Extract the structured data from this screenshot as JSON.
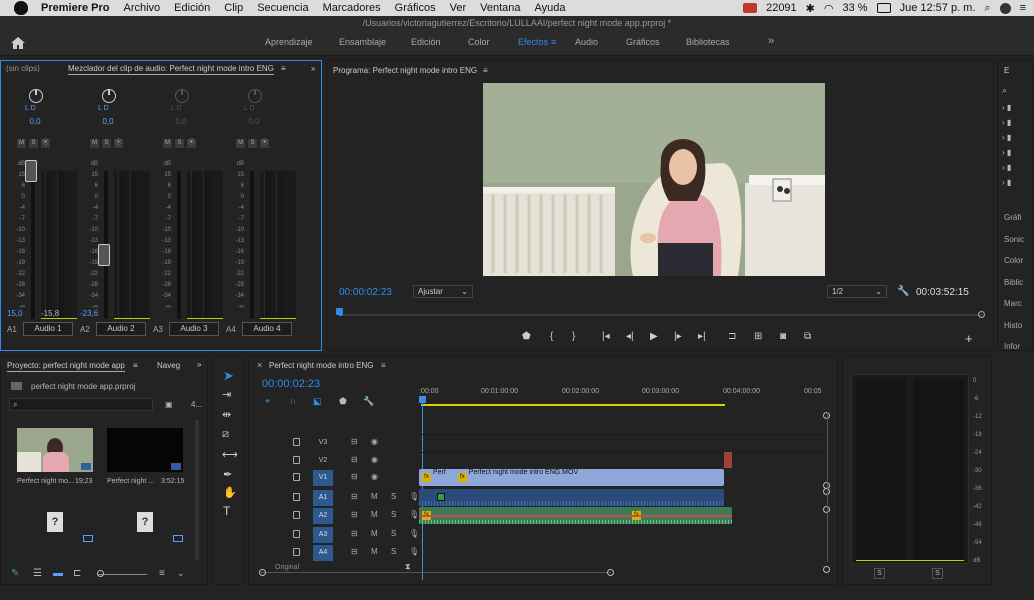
{
  "menubar": {
    "app": "Premiere Pro",
    "items": [
      "Archivo",
      "Edición",
      "Clip",
      "Secuencia",
      "Marcadores",
      "Gráficos",
      "Ver",
      "Ventana",
      "Ayuda"
    ],
    "battery_count": "22091",
    "battery_pct": "33 %",
    "clock": "Jue 12:57 p. m."
  },
  "window_title": "/Usuarios/victoriagutierrez/Escritorio/LULLAAI/perfect night mode app.prproj *",
  "workspaces": {
    "tabs": [
      "Aprendizaje",
      "Ensamblaje",
      "Edición",
      "Color",
      "Efectos",
      "Audio",
      "Gráficos",
      "Bibliotecas"
    ],
    "active": "Efectos",
    "more": "»"
  },
  "mixer": {
    "tab_noclips": "(sin clips)",
    "tab_title": "Mezclador del clip de audio: Perfect night mode intro ENG",
    "lr": "L      D",
    "channels": [
      {
        "id": "A1",
        "name": "Audio 1",
        "pan": "0,0",
        "value_a": "15,0",
        "value_b": "-15,8",
        "active": true,
        "fader_db": 15
      },
      {
        "id": "A2",
        "name": "Audio 2",
        "pan": "0,0",
        "value_a": "-23,6",
        "value_b": "",
        "active": true,
        "fader_db": -23.6
      },
      {
        "id": "A3",
        "name": "Audio 3",
        "pan": "0,0",
        "value_a": "",
        "value_b": "",
        "active": false,
        "fader_db": null
      },
      {
        "id": "A4",
        "name": "Audio 4",
        "pan": "0,0",
        "value_a": "",
        "value_b": "",
        "active": false,
        "fader_db": null
      }
    ],
    "scale": [
      "dB",
      "15",
      "6",
      "0",
      "-4",
      "-7",
      "-10",
      "-13",
      "-16",
      "-19",
      "-22",
      "-28",
      "-34",
      "-∞"
    ],
    "msr": [
      "M",
      "S",
      "⦿"
    ]
  },
  "program": {
    "title": "Programa: Perfect night mode intro ENG",
    "timecode": "00:00:02:23",
    "fit": "Ajustar",
    "resolution": "1/2",
    "duration": "00:03:52:15"
  },
  "right_panel": {
    "header": "E",
    "items": [
      "Gráfi",
      "Sonic",
      "Color",
      "Biblic",
      "Marc",
      "Histo",
      "Infor"
    ]
  },
  "project": {
    "title": "Proyecto: perfect night mode app",
    "tab2": "Naveg",
    "file": "perfect night mode app.prproj",
    "count": "4...",
    "items": [
      {
        "name": "Perfect night mo...",
        "duration": "19;23"
      },
      {
        "name": "Perfect night ...",
        "duration": "3:52:15"
      },
      {
        "name": "",
        "duration": ""
      },
      {
        "name": "",
        "duration": ""
      }
    ]
  },
  "timeline": {
    "title": "Perfect night mode intro ENG",
    "timecode": "00:00:02:23",
    "ruler": [
      ":00:00",
      "00:01:00:00",
      "00:02:00:00",
      "00:03:00:00",
      "00:04:00:00",
      "00:05"
    ],
    "tracks": [
      "V3",
      "V2",
      "V1",
      "A1",
      "A2",
      "A3",
      "A4"
    ],
    "clip_v1_a": "Perf",
    "clip_v1_b": "Perfect night mode intro ENG.MOV",
    "footer": "Original"
  },
  "audio_meter": {
    "scale": [
      "0",
      "-6",
      "-12",
      "-18",
      "-24",
      "-30",
      "-36",
      "-42",
      "-48",
      "-54",
      "dB"
    ],
    "solo": [
      "S",
      "S"
    ]
  },
  "colors": {
    "accent": "#2e8ce6",
    "clip_video": "#8ea9d9",
    "clip_audio": "#3f7a56",
    "playhead": "#3a8fe0"
  }
}
